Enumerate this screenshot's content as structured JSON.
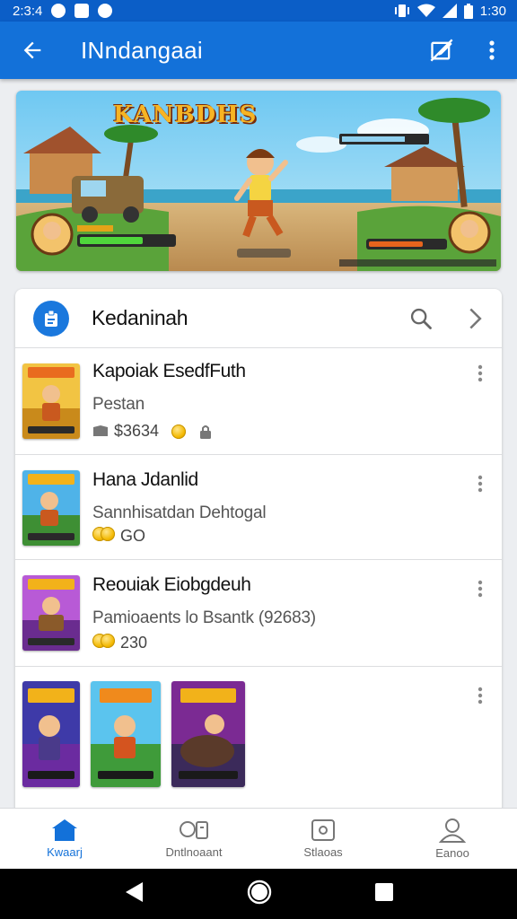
{
  "status_bar": {
    "time_left": "2:3:4",
    "time_right": "1:30"
  },
  "app_bar": {
    "title": "INndangaai",
    "icons": [
      "arrow-back-icon",
      "edit-off-icon",
      "more-vert-icon"
    ]
  },
  "banner": {
    "title": "KANBDHS"
  },
  "card": {
    "header_title": "Kedaninah",
    "header_icons": [
      "clipboard-icon",
      "search-icon",
      "chevron-right-icon"
    ]
  },
  "list": [
    {
      "title": "Kapoiak EsedfFuth",
      "subtitle": "Pestan",
      "meta": "$3634",
      "colors": {
        "top": "#f2c443",
        "bottom": "#c98a1b"
      }
    },
    {
      "title": "Hana Jdanlid",
      "subtitle": "Sannhisatdan Dehtogal",
      "meta": "GO",
      "colors": {
        "top": "#4fb3e8",
        "bottom": "#3e8f34"
      }
    },
    {
      "title": "Reouiak Eiobgdeuh",
      "subtitle": "Pamioaents lo Bsantk (92683)",
      "meta": "230",
      "colors": {
        "top": "#b85ad6",
        "bottom": "#6a2c8f"
      }
    }
  ],
  "gallery": [
    {
      "colors": {
        "top": "#3e3aa8",
        "bottom": "#6b2ba0"
      }
    },
    {
      "colors": {
        "top": "#5bc4ee",
        "bottom": "#3f9b3a"
      }
    },
    {
      "colors": {
        "top": "#7b2a93",
        "bottom": "#3b2a5a"
      }
    }
  ],
  "bottom_nav": [
    {
      "label": "Kwaarj",
      "icon": "home-icon",
      "active": true
    },
    {
      "label": "Dntlnoaant",
      "icon": "devices-icon",
      "active": false
    },
    {
      "label": "Stlaoas",
      "icon": "square-badge-icon",
      "active": false
    },
    {
      "label": "Eanoo",
      "icon": "person-icon",
      "active": false
    }
  ],
  "colors": {
    "status_bar": "#0b5ec7",
    "app_bar": "#1371d9",
    "accent": "#1371d9"
  }
}
